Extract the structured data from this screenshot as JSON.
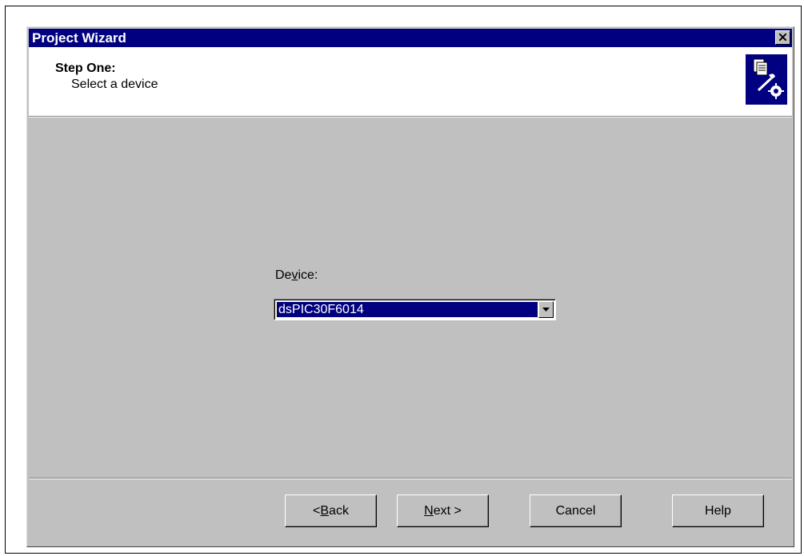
{
  "window": {
    "title": "Project Wizard",
    "close_icon": "close-x-icon"
  },
  "header": {
    "step_title": "Step One:",
    "step_subtitle": "Select a device",
    "icon": "wizard-documents-tools-icon"
  },
  "device": {
    "label_pre": "De",
    "label_mnemonic": "v",
    "label_post": "ice:",
    "selected_value": "dsPIC30F6014",
    "dropdown_icon": "chevron-down-icon"
  },
  "buttons": {
    "back_pre": "< ",
    "back_mnemonic": "B",
    "back_post": "ack",
    "next_mnemonic": "N",
    "next_post": "ext >",
    "cancel": "Cancel",
    "help": "Help"
  },
  "colors": {
    "titlebar": "#000080",
    "dialog_bg": "#c0c0c0",
    "selection": "#000080"
  }
}
